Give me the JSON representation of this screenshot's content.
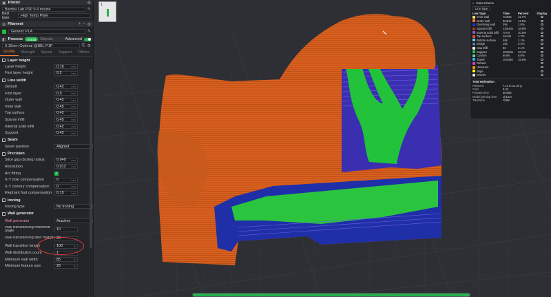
{
  "printer": {
    "title": "Printer",
    "name": "Bambu Lab P1P 0.4 nozzle",
    "bed_type_label": "Bed type",
    "bed_type_value": "High Temp Plate"
  },
  "filament": {
    "title": "Filament",
    "item": "Generic PLA"
  },
  "process": {
    "title": "Process",
    "mode_global": "Global",
    "mode_objects": "Objects",
    "advanced_label": "Advanced",
    "preset": "0.16mm Optimal @BBL P1P"
  },
  "tabs": [
    "Quality",
    "Strength",
    "Speed",
    "Support",
    "Others"
  ],
  "groups": {
    "layer_height": {
      "title": "Layer height",
      "items": [
        {
          "label": "Layer height",
          "value": "0.16",
          "unit": "mm"
        },
        {
          "label": "First layer height",
          "value": "0.2",
          "unit": "mm"
        }
      ]
    },
    "line_width": {
      "title": "Line width",
      "items": [
        {
          "label": "Default",
          "value": "0.42",
          "unit": "mm"
        },
        {
          "label": "First layer",
          "value": "0.5",
          "unit": "mm"
        },
        {
          "label": "Outer wall",
          "value": "0.42",
          "unit": "mm"
        },
        {
          "label": "Inner wall",
          "value": "0.45",
          "unit": "mm"
        },
        {
          "label": "Top surface",
          "value": "0.42",
          "unit": "mm"
        },
        {
          "label": "Sparse infill",
          "value": "0.45",
          "unit": "mm"
        },
        {
          "label": "Internal solid infill",
          "value": "0.42",
          "unit": "mm"
        },
        {
          "label": "Support",
          "value": "0.42",
          "unit": "mm"
        }
      ]
    },
    "seam": {
      "title": "Seam",
      "position_label": "Seam position",
      "position_value": "Aligned"
    },
    "precision": {
      "title": "Precision",
      "slice_gap_label": "Slice gap closing radius",
      "slice_gap_value": "0.049",
      "slice_gap_unit": "mm",
      "resolution_label": "Resolution",
      "resolution_value": "0.012",
      "resolution_unit": "mm",
      "arc_label": "Arc fitting",
      "xy_hole_label": "X-Y hole compensation",
      "xy_hole_value": "0",
      "xy_hole_unit": "mm",
      "xy_contour_label": "X-Y contour compensation",
      "xy_contour_value": "0",
      "xy_contour_unit": "mm",
      "elephant_label": "Elephant foot compensation",
      "elephant_value": "0.15",
      "elephant_unit": "mm"
    },
    "ironing": {
      "title": "Ironing",
      "type_label": "Ironing type",
      "type_value": "No ironing"
    },
    "wall_generator": {
      "title": "Wall generator",
      "gen_label": "Wall generator",
      "gen_value": "Arachne",
      "threshold_label": "Wall transitioning threshold angle",
      "threshold_value": "10",
      "filter_label": "Wall transitioning filter margin",
      "filter_value": "25",
      "filter_unit": "%",
      "length_label": "Wall transition length",
      "length_value": "100",
      "length_unit": "%",
      "dist_label": "Wall distribution count",
      "dist_value": "1",
      "min_width_label": "Minimum wall width",
      "min_width_value": "85",
      "min_width_unit": "%",
      "min_feature_label": "Minimum feature size",
      "min_feature_value": "25",
      "min_feature_unit": "%"
    }
  },
  "plate": {
    "number": "1"
  },
  "legend": {
    "title": "Color scheme",
    "scheme": "Line Type",
    "col_type": "Line Type",
    "col_time": "Time",
    "col_percent": "Percent",
    "col_display": "Display",
    "rows": [
      {
        "name": "Inner wall",
        "time": "7m54s",
        "percent": "11.7%",
        "color": "#ffe36a"
      },
      {
        "name": "Outer wall",
        "time": "9m51s",
        "percent": "14.5%",
        "color": "#ff7d38"
      },
      {
        "name": "Overhang wall",
        "time": "39s",
        "percent": "1.0%",
        "color": "#1f2fd6"
      },
      {
        "name": "Sparse infill",
        "time": "12m44s",
        "percent": "18.8%",
        "color": "#b03029"
      },
      {
        "name": "Internal solid infill",
        "time": "7m7s",
        "percent": "10.6%",
        "color": "#9654cc"
      },
      {
        "name": "Top surface",
        "time": "1m11s",
        "percent": "1.7%",
        "color": "#f04040"
      },
      {
        "name": "Bottom surface",
        "time": "46s",
        "percent": "1.1%",
        "color": "#66ccee"
      },
      {
        "name": "Bridge",
        "time": "16s",
        "percent": "0.4%",
        "color": "#4d80ba"
      },
      {
        "name": "Gap infill",
        "time": "6s",
        "percent": "0.1%",
        "color": "#ffffff"
      },
      {
        "name": "Support",
        "time": "10m54s",
        "percent": "16.1%",
        "color": "#21c23a"
      },
      {
        "name": "Custom",
        "time": "6m5s",
        "percent": "9.0%",
        "color": "#5fd1a0"
      },
      {
        "name": "Travel",
        "time": "10m36s",
        "percent": "15.6%",
        "color": "#38b0ff"
      },
      {
        "name": "Retract",
        "time": "",
        "percent": "",
        "color": "#cc44cc"
      },
      {
        "name": "Unretract",
        "time": "",
        "percent": "",
        "color": "#ff8c00"
      },
      {
        "name": "Wipe",
        "time": "",
        "percent": "",
        "color": "#ffff00"
      },
      {
        "name": "Seams",
        "time": "",
        "percent": "",
        "color": "#e6e6e6"
      }
    ],
    "total_title": "Total estimation",
    "filament_label": "Filament",
    "filament_value": "7.11 m    21.20 g",
    "cost_label": "Cost",
    "cost_value": "0.42",
    "prepare_label": "Prepare time",
    "prepare_value": "5m48s",
    "model_label": "Model printing time",
    "model_value": "1h12m",
    "total_label": "Total time",
    "total_value": "1h8m"
  },
  "slider": {
    "progress_percent": 100
  }
}
